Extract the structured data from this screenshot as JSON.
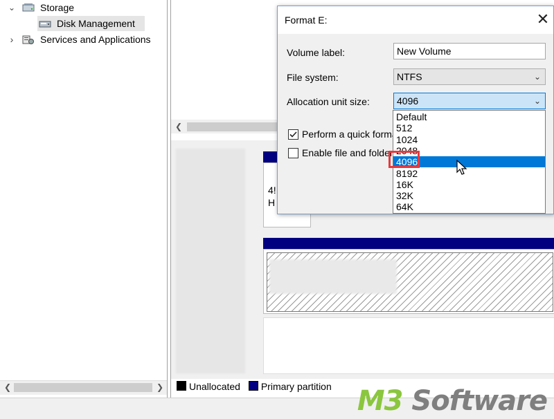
{
  "tree": {
    "storage_label": "Storage",
    "disk_management_label": "Disk Management",
    "services_label": "Services and Applications"
  },
  "legend": {
    "unallocated_label": "Unallocated",
    "primary_partition_label": "Primary partition",
    "unallocated_color": "#000000",
    "primary_partition_color": "#000080"
  },
  "partial_text": {
    "upper_disk": "4!",
    "upper_disk_line2": "H"
  },
  "dialog": {
    "title": "Format E:",
    "volume_label_label": "Volume label:",
    "volume_label_value": "New Volume",
    "file_system_label": "File system:",
    "file_system_value": "NTFS",
    "allocation_label": "Allocation unit size:",
    "allocation_value": "4096",
    "quick_format_label": "Perform a quick format",
    "quick_format_checked": true,
    "compression_label": "Enable file and folder",
    "compression_checked": false
  },
  "allocation_options": [
    "Default",
    "512",
    "1024",
    "2048",
    "4096",
    "8192",
    "16K",
    "32K",
    "64K"
  ],
  "selected_option_index": 4,
  "watermark": {
    "part1": "M3",
    "part2": " Software",
    "color1": "#8bc63f",
    "color2": "#7f7f7f"
  },
  "icons": {
    "close": "close-icon",
    "chevron_down": "chevron-down-icon",
    "chevron_right": "chevron-right-icon",
    "cursor": "mouse-pointer-icon"
  }
}
